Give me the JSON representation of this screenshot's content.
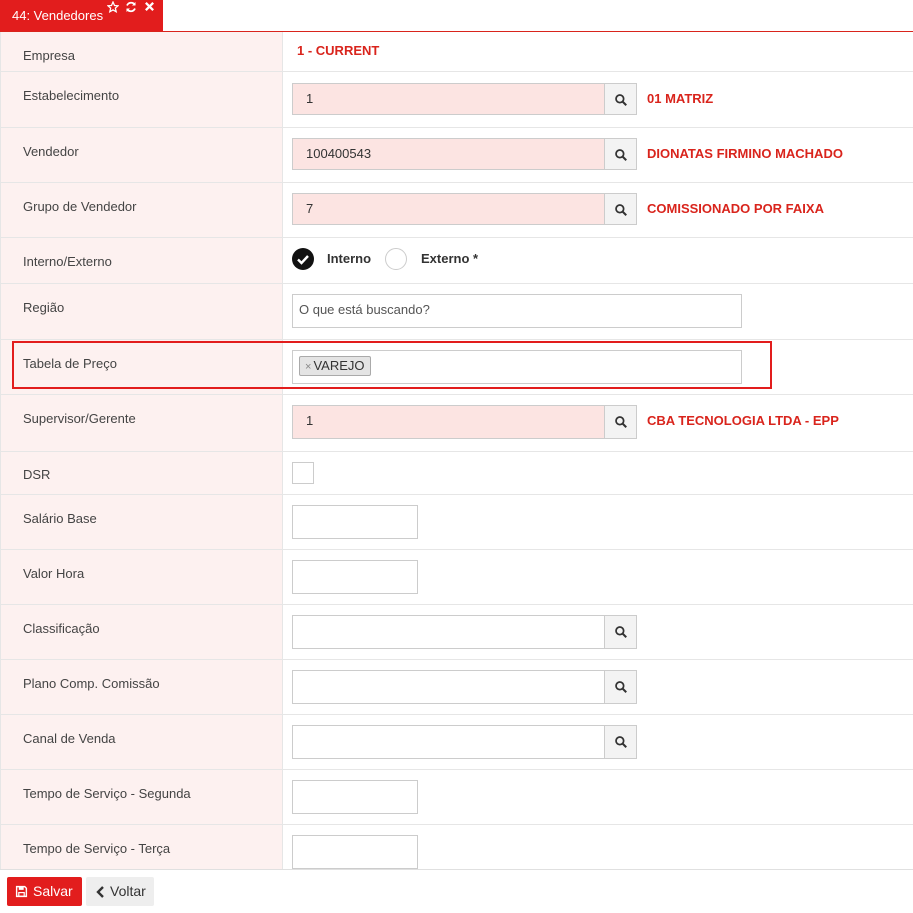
{
  "tab": {
    "label": "44: Vendedores"
  },
  "fields": {
    "empresa": {
      "label": "Empresa",
      "value": "1 - CURRENT"
    },
    "estabelecimento": {
      "label": "Estabelecimento",
      "value": "1",
      "desc": "01 MATRIZ"
    },
    "vendedor": {
      "label": "Vendedor",
      "value": "100400543",
      "desc": "DIONATAS FIRMINO MACHADO"
    },
    "grupo": {
      "label": "Grupo de Vendedor",
      "value": "7",
      "desc": "COMISSIONADO POR FAIXA"
    },
    "interno_externo": {
      "label": "Interno/Externo",
      "opt1": "Interno",
      "opt2": "Externo *",
      "selected": "Interno"
    },
    "regiao": {
      "label": "Região",
      "placeholder": "O que está buscando?"
    },
    "tabela_preco": {
      "label": "Tabela de Preço",
      "tag": "VAREJO",
      "tag_remove": "×"
    },
    "supervisor": {
      "label": "Supervisor/Gerente",
      "value": "1",
      "desc": "CBA TECNOLOGIA LTDA - EPP"
    },
    "dsr": {
      "label": "DSR",
      "checked": false
    },
    "salario_base": {
      "label": "Salário Base",
      "value": ""
    },
    "valor_hora": {
      "label": "Valor Hora",
      "value": ""
    },
    "classificacao": {
      "label": "Classificação",
      "value": ""
    },
    "plano_comissao": {
      "label": "Plano Comp. Comissão",
      "value": ""
    },
    "canal_venda": {
      "label": "Canal de Venda",
      "value": ""
    },
    "tempo_segunda": {
      "label": "Tempo de Serviço - Segunda",
      "value": ""
    },
    "tempo_terca": {
      "label": "Tempo de Serviço - Terça",
      "value": ""
    }
  },
  "footer": {
    "save_label": "Salvar",
    "back_label": "Voltar"
  },
  "colors": {
    "accent": "#e21d1d",
    "label_bg": "#fdf1f0",
    "required_bg": "#fce4e2"
  }
}
